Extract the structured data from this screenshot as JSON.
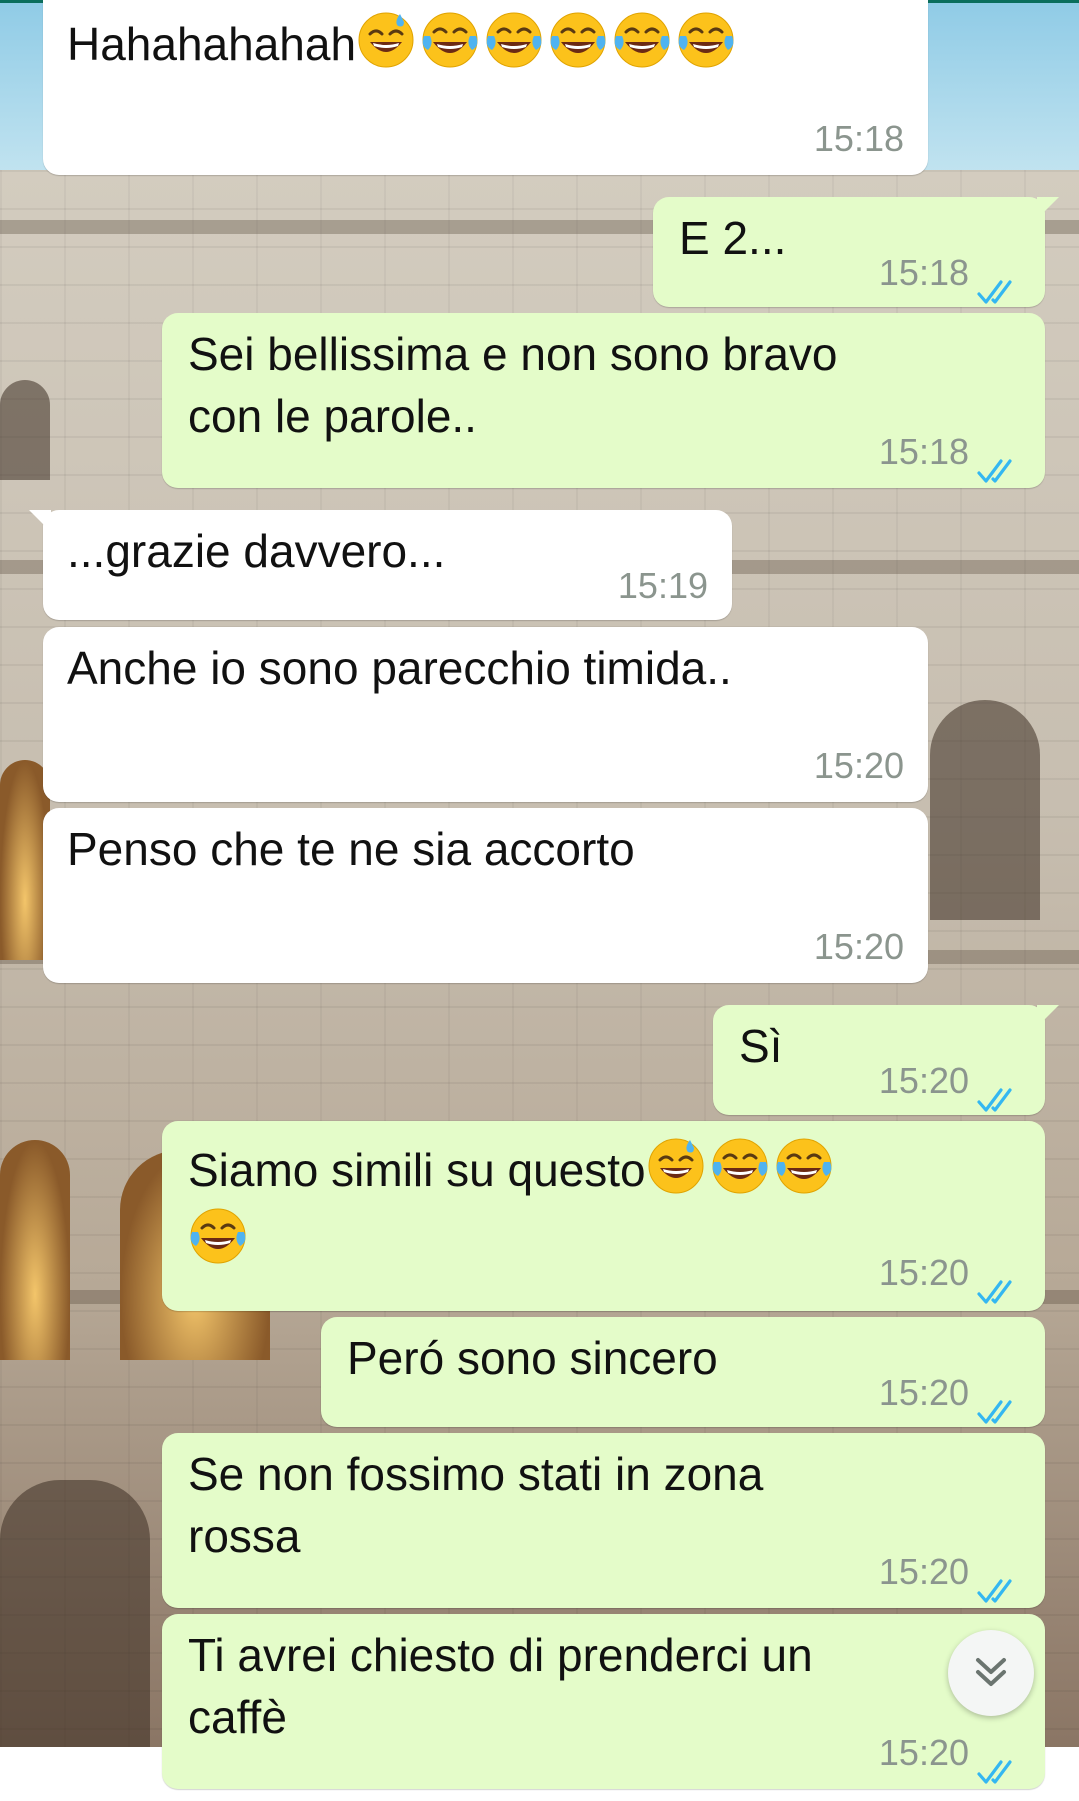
{
  "messages": [
    {
      "id": "m1",
      "dir": "in",
      "text": "Hahahahahah",
      "emojis": [
        "sweat-smile",
        "joy",
        "joy",
        "joy",
        "joy",
        "joy"
      ],
      "time": "15:18"
    },
    {
      "id": "m2",
      "dir": "out",
      "text": "E 2...",
      "time": "15:18",
      "status": "read"
    },
    {
      "id": "m3",
      "dir": "out",
      "text": "Sei bellissima e non sono bravo\ncon le parole..",
      "time": "15:18",
      "status": "read"
    },
    {
      "id": "m4",
      "dir": "in",
      "text": "...grazie davvero...",
      "time": "15:19"
    },
    {
      "id": "m5",
      "dir": "in",
      "text": "Anche io sono parecchio timida..",
      "time": "15:20"
    },
    {
      "id": "m6",
      "dir": "in",
      "text": "Penso che te ne sia accorto",
      "time": "15:20"
    },
    {
      "id": "m7",
      "dir": "out",
      "text": "Sì",
      "time": "15:20",
      "status": "read"
    },
    {
      "id": "m8",
      "dir": "out",
      "text": "Siamo simili su questo",
      "emojis": [
        "sweat-smile",
        "joy",
        "joy",
        "joy"
      ],
      "time": "15:20",
      "status": "read"
    },
    {
      "id": "m9",
      "dir": "out",
      "text": "Peró sono sincero",
      "time": "15:20",
      "status": "read"
    },
    {
      "id": "m10",
      "dir": "out",
      "text": "Se non fossimo stati in zona\nrossa",
      "time": "15:20",
      "status": "read"
    },
    {
      "id": "m11",
      "dir": "out",
      "text": "Ti avrei chiesto di prenderci un\ncaffè",
      "time": "15:20",
      "status": "read"
    }
  ],
  "colors": {
    "incoming": "#ffffff",
    "outgoing": "#e4fcc9",
    "read_ticks": "#34b7f1",
    "time": "#8b958e"
  },
  "scroll_button": {
    "icon": "double-chevron-down-icon"
  }
}
